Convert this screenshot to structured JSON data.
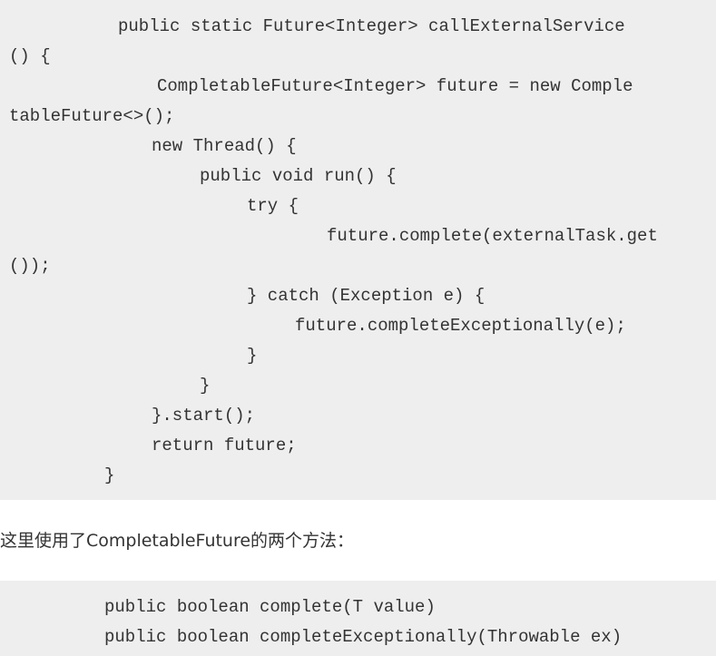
{
  "code_block_1": {
    "lines": [
      "public static Future<Integer> callExternalService",
      "() {",
      "CompletableFuture<Integer> future = new Comple",
      "tableFuture<>();",
      "new Thread() {",
      "public void run() {",
      "try {",
      "future.complete(externalTask.get",
      "());",
      "} catch (Exception e) {",
      "future.completeExceptionally(e);",
      "}",
      "}",
      "}.start();",
      "return future;",
      "}"
    ]
  },
  "paragraph": "这里使用了CompletableFuture的两个方法：",
  "code_block_2": {
    "lines": [
      "public boolean complete(T value)",
      "public boolean completeExceptionally(Throwable ex)"
    ]
  }
}
